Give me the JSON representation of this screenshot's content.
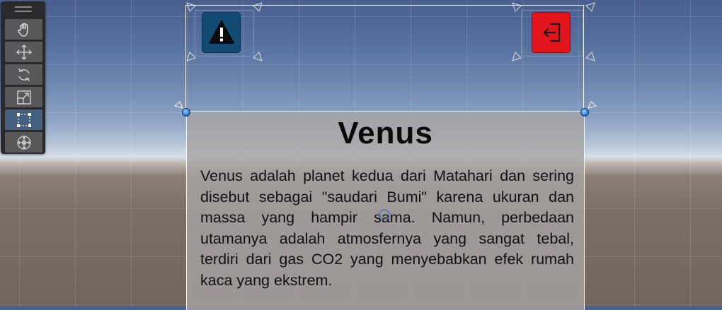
{
  "scene": {
    "colors": {
      "sky": "#56709e",
      "ground": "#7a6f66",
      "selection": "#ffffff",
      "pivot": "#2c7fd6"
    }
  },
  "toolbar": {
    "tools": [
      {
        "name": "hand-tool",
        "icon": "hand-icon",
        "active": false
      },
      {
        "name": "move-tool",
        "icon": "move-arrows-icon",
        "active": false
      },
      {
        "name": "rotate-tool",
        "icon": "rotate-icon",
        "active": false
      },
      {
        "name": "scale-tool",
        "icon": "scale-icon",
        "active": false
      },
      {
        "name": "rect-tool",
        "icon": "rect-transform-icon",
        "active": true
      },
      {
        "name": "transform-tool",
        "icon": "transform-icon",
        "active": false
      }
    ]
  },
  "buttons": {
    "warning": {
      "icon": "warning-icon",
      "color": "#114a72"
    },
    "exit": {
      "icon": "exit-icon",
      "color": "#e3141b"
    }
  },
  "panel": {
    "title": "Venus",
    "body": "Venus adalah planet kedua dari Matahari dan sering disebut sebagai \"saudari Bumi\" karena ukuran dan massa yang hampir sama. Namun, perbedaan utamanya adalah atmosfernya yang sangat tebal, terdiri dari gas CO2 yang menyebabkan efek rumah kaca yang ekstrem."
  }
}
